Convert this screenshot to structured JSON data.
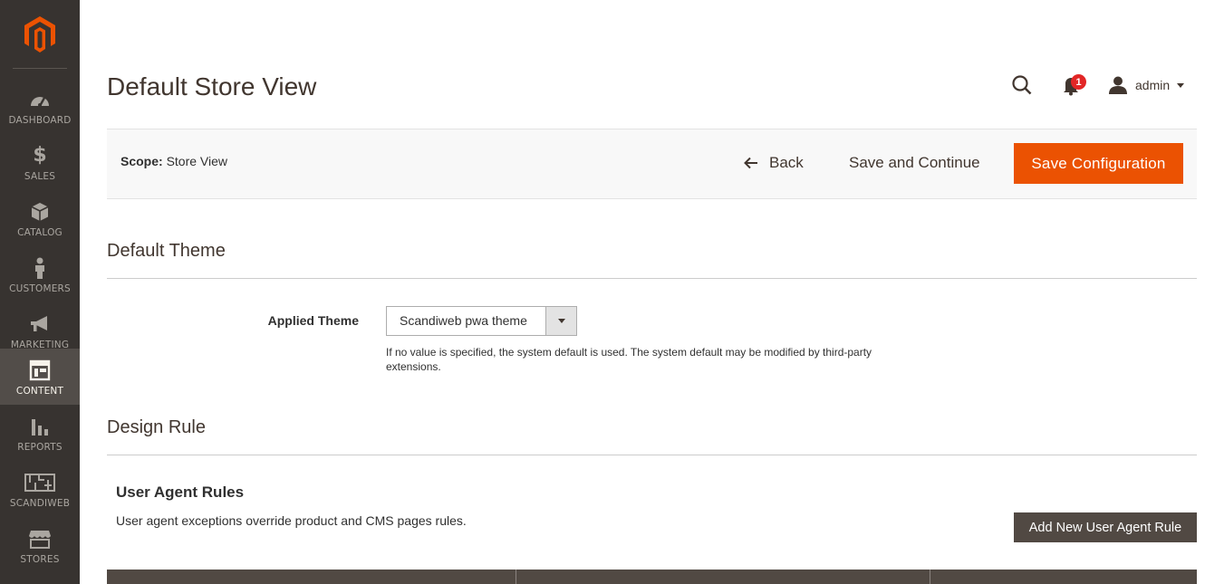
{
  "sidebar": {
    "items": [
      {
        "label": "DASHBOARD",
        "icon": "dashboard-icon"
      },
      {
        "label": "SALES",
        "icon": "dollar-icon"
      },
      {
        "label": "CATALOG",
        "icon": "box-icon"
      },
      {
        "label": "CUSTOMERS",
        "icon": "person-icon"
      },
      {
        "label": "MARKETING",
        "icon": "megaphone-icon"
      },
      {
        "label": "CONTENT",
        "icon": "layout-icon",
        "active": true
      },
      {
        "label": "REPORTS",
        "icon": "bar-chart-icon"
      },
      {
        "label": "SCANDIWEB",
        "icon": "scandiweb-icon"
      },
      {
        "label": "STORES",
        "icon": "storefront-icon"
      }
    ]
  },
  "header": {
    "title": "Default Store View",
    "notifications_count": "1",
    "user_name": "admin"
  },
  "action_bar": {
    "scope_label": "Scope:",
    "scope_value": "Store View",
    "back_label": "Back",
    "save_continue_label": "Save and Continue",
    "save_config_label": "Save Configuration"
  },
  "default_theme": {
    "title": "Default Theme",
    "field_label": "Applied Theme",
    "selected_value": "Scandiweb pwa theme",
    "note": "If no value is specified, the system default is used. The system default may be modified by third-party extensions."
  },
  "design_rule": {
    "title": "Design Rule",
    "subtitle": "User Agent Rules",
    "description": "User agent exceptions override product and CMS pages rules.",
    "add_button_label": "Add New User Agent Rule"
  },
  "colors": {
    "accent": "#eb5202",
    "sidebar_bg": "#373330",
    "sidebar_active": "#524d49",
    "dark_button": "#514943",
    "badge": "#e22626"
  }
}
